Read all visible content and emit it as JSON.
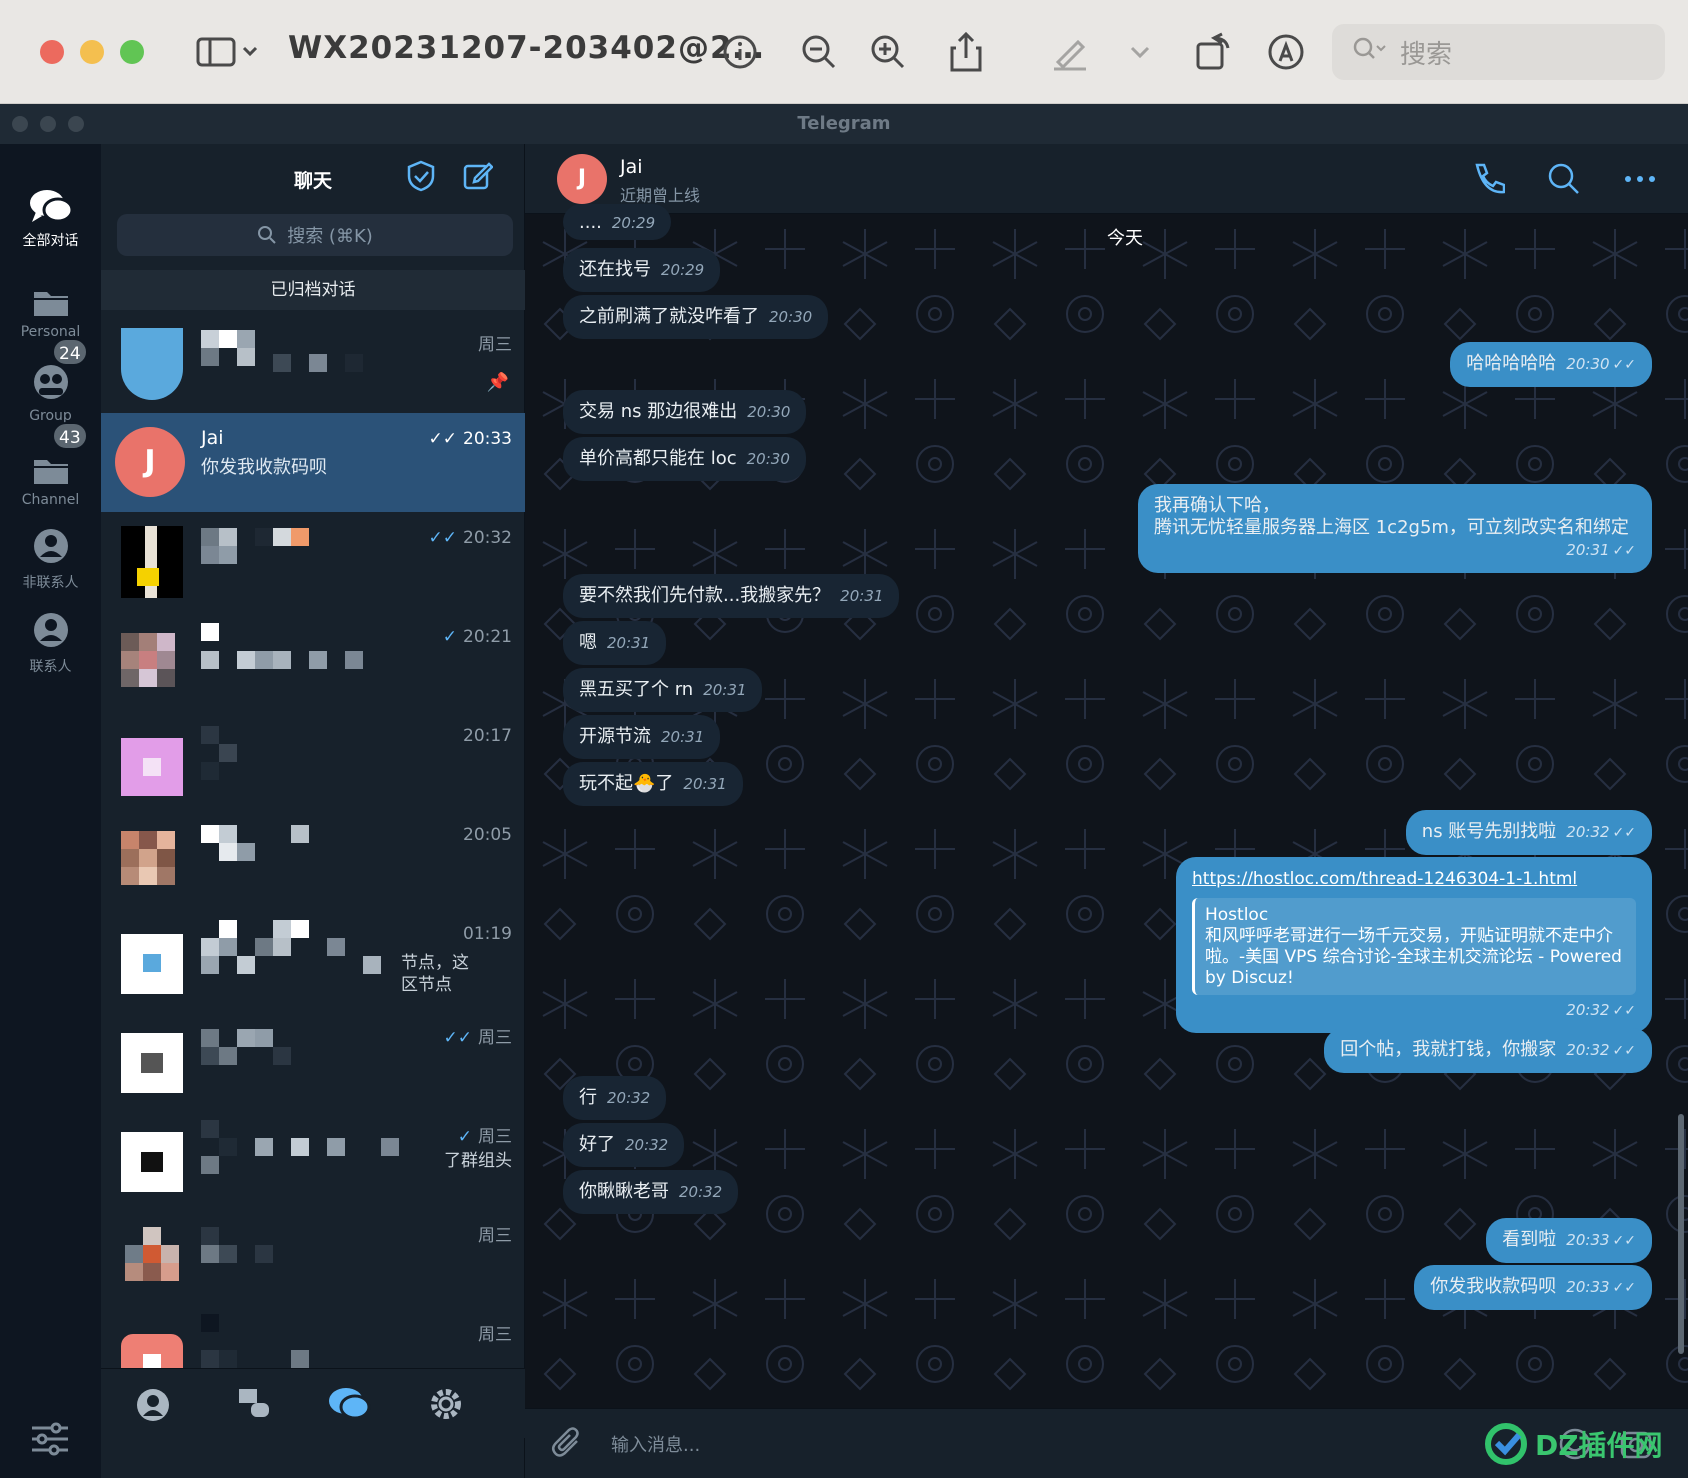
{
  "window": {
    "file_title": "WX20231207-203402@2…",
    "search_placeholder": "搜索",
    "app_title": "Telegram"
  },
  "colors": {
    "accent": "#5eb5f7",
    "selected_row": "#2b5278",
    "avatar_jai": "#e9736a",
    "bg": "#17212b"
  },
  "folders": [
    {
      "label": "全部对话",
      "icon": "chats-icon",
      "badge": ""
    },
    {
      "label": "Personal",
      "icon": "folder-icon",
      "badge": ""
    },
    {
      "label": "Group",
      "icon": "group-icon",
      "badge": "24"
    },
    {
      "label": "Channel",
      "icon": "channel-icon",
      "badge": "43"
    },
    {
      "label": "非联系人",
      "icon": "person-icon",
      "badge": ""
    },
    {
      "label": "联系人",
      "icon": "contact-icon",
      "badge": ""
    }
  ],
  "chatlist": {
    "title": "聊天",
    "search_placeholder": "搜索 (⌘K)",
    "archived_label": "已归档对话",
    "rows": [
      {
        "name": "",
        "preview": "",
        "time": "周三",
        "extra": ""
      },
      {
        "name": "Jai",
        "preview": "你发我收款码呗",
        "time": "20:33",
        "extra": "",
        "avatar_letter": "J"
      },
      {
        "name": "",
        "preview": "",
        "time": "20:32",
        "extra": ""
      },
      {
        "name": "",
        "preview": "",
        "time": "20:21",
        "extra": ""
      },
      {
        "name": "",
        "preview": "",
        "time": "20:17",
        "extra": ""
      },
      {
        "name": "",
        "preview": "",
        "time": "20:05",
        "extra": ""
      },
      {
        "name": "",
        "preview": "",
        "time": "01:19",
        "extra": "节点，这\n区节点"
      },
      {
        "name": "",
        "preview": "",
        "time": "周三",
        "extra": ""
      },
      {
        "name": "",
        "preview": "",
        "time": "周三",
        "extra": "了群组头"
      },
      {
        "name": "",
        "preview": "",
        "time": "周三",
        "extra": ""
      },
      {
        "name": "",
        "preview": "",
        "time": "周三",
        "extra": ""
      }
    ]
  },
  "chat": {
    "name": "Jai",
    "avatar_letter": "J",
    "status": "近期曾上线",
    "date_label": "今天",
    "composer_placeholder": "输入消息...",
    "messages": [
      {
        "dir": "in",
        "text": "....",
        "time": "20:29"
      },
      {
        "dir": "in",
        "text": "还在找号",
        "time": "20:29"
      },
      {
        "dir": "in",
        "text": "之前刷满了就没咋看了",
        "time": "20:30"
      },
      {
        "dir": "out",
        "text": "哈哈哈哈哈",
        "time": "20:30"
      },
      {
        "dir": "in",
        "text": "交易 ns 那边很难出",
        "time": "20:30"
      },
      {
        "dir": "in",
        "text": "单价高都只能在 loc",
        "time": "20:30"
      },
      {
        "dir": "out",
        "text": "我再确认下哈，",
        "text2": "腾讯无忧轻量服务器上海区 1c2g5m，可立刻改实名和绑定",
        "time": "20:31"
      },
      {
        "dir": "in",
        "text": "要不然我们先付款...我搬家先？",
        "time": "20:31"
      },
      {
        "dir": "in",
        "text": "嗯",
        "time": "20:31"
      },
      {
        "dir": "in",
        "text": "黑五买了个 rn",
        "time": "20:31"
      },
      {
        "dir": "in",
        "text": "开源节流",
        "time": "20:31"
      },
      {
        "dir": "in",
        "text": "玩不起🐣了",
        "time": "20:31"
      },
      {
        "dir": "out",
        "text": "ns 账号先别找啦",
        "time": "20:32"
      },
      {
        "dir": "out",
        "link": "https://hostloc.com/thread-1246304-1-1.html",
        "preview_site": "Hostloc",
        "preview_text": "和风呼呼老哥进行一场千元交易，开贴证明就不走中介啦。-美国 VPS 综合讨论-全球主机交流论坛 - Powered by Discuz!",
        "time": "20:32"
      },
      {
        "dir": "out",
        "text": "回个帖，我就打钱，你搬家",
        "time": "20:32"
      },
      {
        "dir": "in",
        "text": "行",
        "time": "20:32"
      },
      {
        "dir": "in",
        "text": "好了",
        "time": "20:32"
      },
      {
        "dir": "in",
        "text": "你瞅瞅老哥",
        "time": "20:32"
      },
      {
        "dir": "out",
        "text": "看到啦",
        "time": "20:33"
      },
      {
        "dir": "out",
        "text": "你发我收款码呗",
        "time": "20:33"
      }
    ]
  },
  "watermark": "DZ插件网"
}
